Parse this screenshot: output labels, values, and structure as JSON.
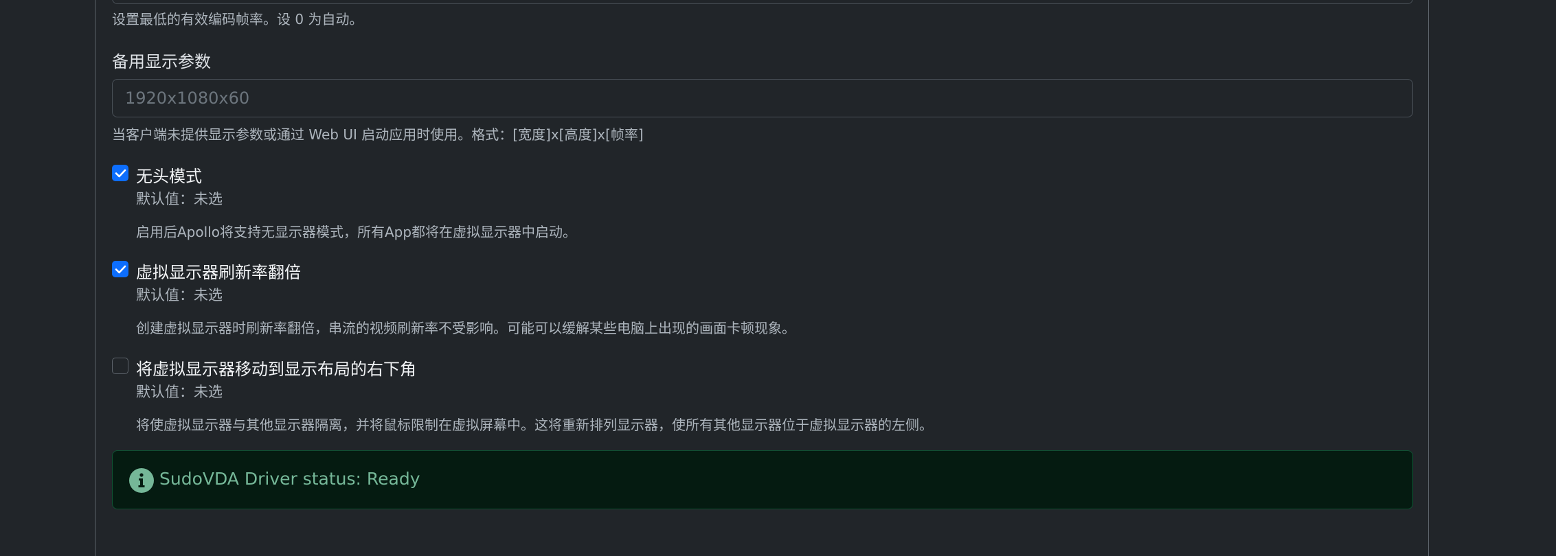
{
  "top_field": {
    "help": "设置最低的有效编码帧率。设 0 为自动。"
  },
  "fallback_display": {
    "label": "备用显示参数",
    "placeholder": "1920x1080x60",
    "value": "",
    "help": "当客户端未提供显示参数或通过 Web UI 启动应用时使用。格式：[宽度]x[高度]x[帧率]"
  },
  "options": [
    {
      "title": "无头模式",
      "default": "默认值：未选",
      "description": "启用后Apollo将支持无显示器模式，所有App都将在虚拟显示器中启动。",
      "checked": true
    },
    {
      "title": "虚拟显示器刷新率翻倍",
      "default": "默认值：未选",
      "description": "创建虚拟显示器时刷新率翻倍，串流的视频刷新率不受影响。可能可以缓解某些电脑上出现的画面卡顿现象。",
      "checked": true
    },
    {
      "title": "将虚拟显示器移动到显示布局的右下角",
      "default": "默认值：未选",
      "description": "将使虚拟显示器与其他显示器隔离，并将鼠标限制在虚拟屏幕中。这将重新排列显示器，使所有其他显示器位于虚拟显示器的左侧。",
      "checked": false
    }
  ],
  "alert": {
    "icon": "info-circle-icon",
    "text": "SudoVDA Driver status: Ready"
  },
  "colors": {
    "background": "#212529",
    "checkbox_checked": "#0d6efd",
    "alert_background": "#051b11",
    "alert_border": "#0f5132",
    "alert_text": "#75b798"
  }
}
